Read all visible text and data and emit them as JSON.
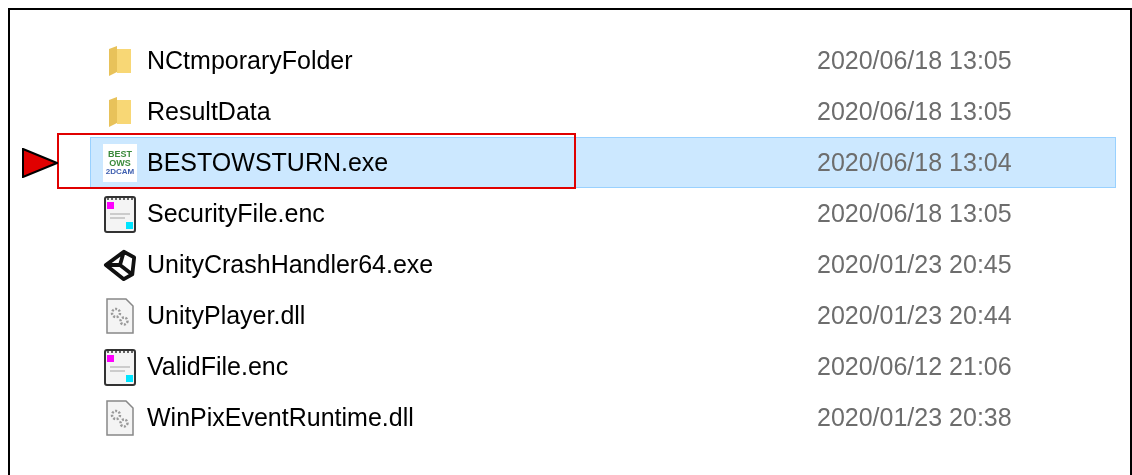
{
  "files": [
    {
      "kind": "folder",
      "name": "NCtmporaryFolder",
      "modified": "2020/06/18 13:05",
      "selected": false,
      "callout": false
    },
    {
      "kind": "folder",
      "name": "ResultData",
      "modified": "2020/06/18 13:05",
      "selected": false,
      "callout": false
    },
    {
      "kind": "app",
      "name": "BESTOWSTURN.exe",
      "modified": "2020/06/18 13:04",
      "selected": true,
      "callout": true,
      "icon_text": [
        "BEST",
        "OWS",
        "2DCAM"
      ]
    },
    {
      "kind": "notepad",
      "name": "SecurityFile.enc",
      "modified": "2020/06/18 13:05",
      "selected": false,
      "callout": false
    },
    {
      "kind": "unity",
      "name": "UnityCrashHandler64.exe",
      "modified": "2020/01/23 20:45",
      "selected": false,
      "callout": false
    },
    {
      "kind": "dll",
      "name": "UnityPlayer.dll",
      "modified": "2020/01/23 20:44",
      "selected": false,
      "callout": false
    },
    {
      "kind": "notepad",
      "name": "ValidFile.enc",
      "modified": "2020/06/12 21:06",
      "selected": false,
      "callout": false
    },
    {
      "kind": "dll",
      "name": "WinPixEventRuntime.dll",
      "modified": "2020/01/23 20:38",
      "selected": false,
      "callout": false
    }
  ]
}
